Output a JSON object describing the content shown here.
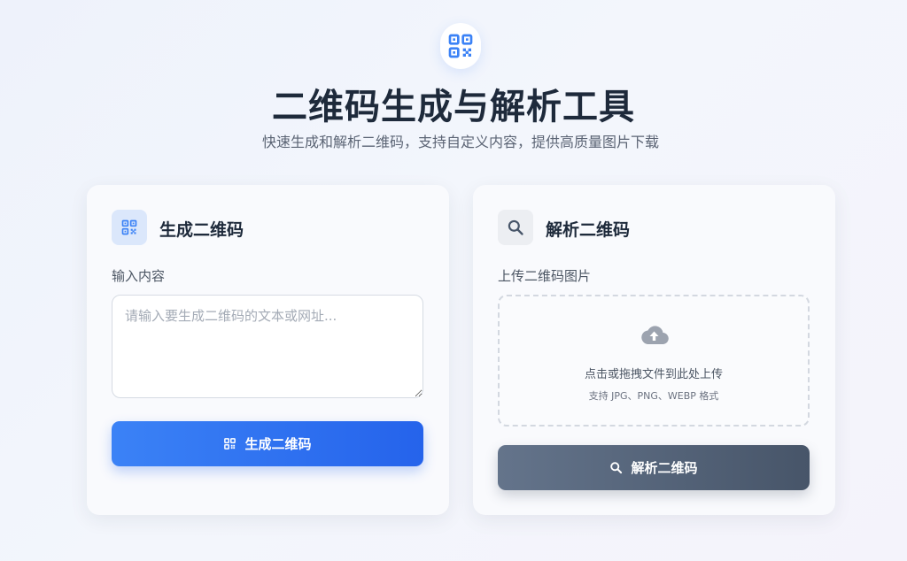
{
  "header": {
    "logo_icon": "qrcode-icon",
    "title": "二维码生成与解析工具",
    "subtitle": "快速生成和解析二维码，支持自定义内容，提供高质量图片下载"
  },
  "generate": {
    "icon": "qrcode-icon",
    "title": "生成二维码",
    "input_label": "输入内容",
    "input_value": "",
    "input_placeholder": "请输入要生成二维码的文本或网址...",
    "button_icon": "qrcode-icon",
    "button_label": "生成二维码"
  },
  "parse": {
    "icon": "search-icon",
    "title": "解析二维码",
    "upload_label": "上传二维码图片",
    "upload_icon": "cloud-upload-icon",
    "upload_text": "点击或拖拽文件到此处上传",
    "upload_hint": "支持 JPG、PNG、WEBP 格式",
    "button_icon": "search-icon",
    "button_label": "解析二维码"
  },
  "colors": {
    "primary": "#3b82f6",
    "primary_dark": "#2563eb",
    "slate": "#64748b",
    "slate_dark": "#475569",
    "title": "#1e2a3b"
  }
}
